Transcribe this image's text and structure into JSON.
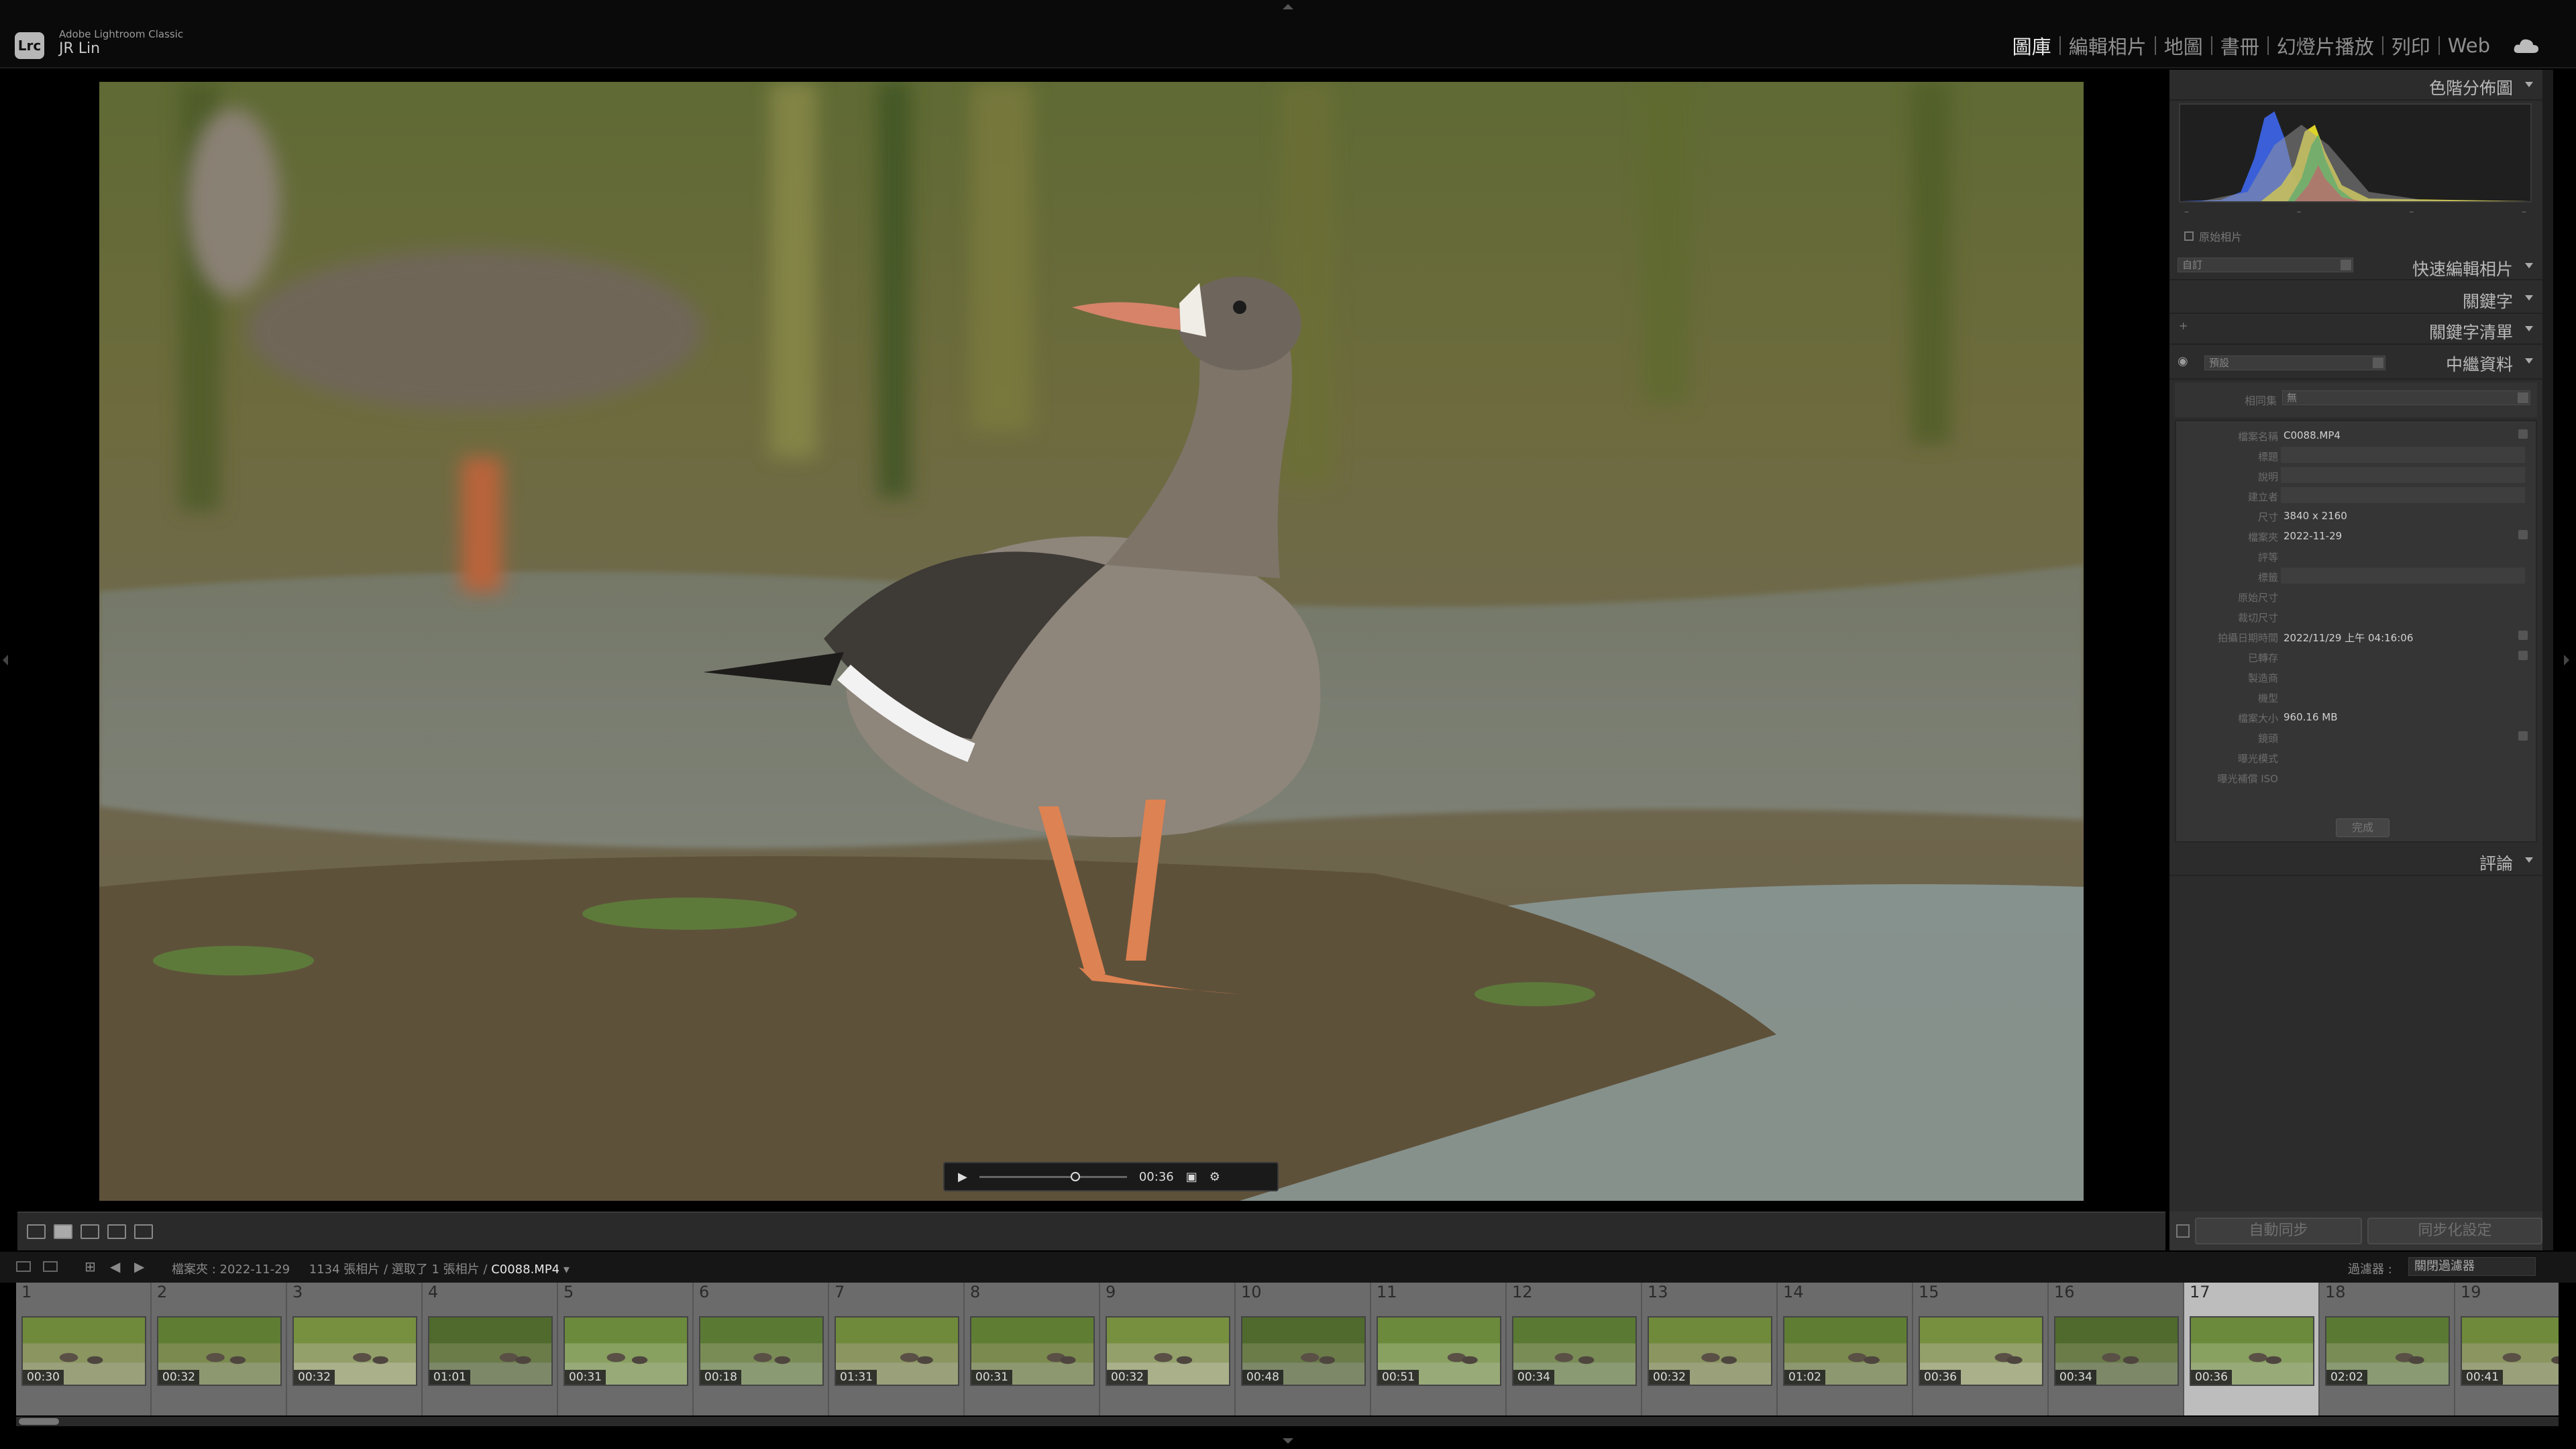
{
  "app": {
    "logo": "Lrc",
    "name": "Adobe Lightroom Classic",
    "user": "JR Lin"
  },
  "modules": [
    {
      "label": "圖庫",
      "active": true
    },
    {
      "label": "編輯相片",
      "active": false
    },
    {
      "label": "地圖",
      "active": false
    },
    {
      "label": "書冊",
      "active": false
    },
    {
      "label": "幻燈片播放",
      "active": false
    },
    {
      "label": "列印",
      "active": false
    },
    {
      "label": "Web",
      "active": false
    }
  ],
  "video": {
    "play_glyph": "▶",
    "time": "00:36",
    "progress": 0.62
  },
  "panels": {
    "histogram": "色階分佈圖",
    "quick_develop": "快速編輯相片",
    "keywording": "關鍵字",
    "keyword_list": "關鍵字清單",
    "metadata": "中繼資料",
    "comments": "評論"
  },
  "histogram": {
    "original_photo": "原始相片",
    "ticks": [
      "–",
      "–",
      "–",
      "–"
    ]
  },
  "quick_develop": {
    "preset": "自訂"
  },
  "metadata": {
    "preset": "預設",
    "target_label": "相同集",
    "target_value": "無",
    "rows": [
      {
        "label": "檔案名稱",
        "value": "C0088.MP4",
        "field": false,
        "button": true
      },
      {
        "label": "標題",
        "value": "",
        "field": true,
        "button": false
      },
      {
        "label": "說明",
        "value": "",
        "field": true,
        "button": false
      },
      {
        "label": "建立者",
        "value": "",
        "field": true,
        "button": false
      },
      {
        "label": "尺寸",
        "value": "3840 x 2160",
        "field": false,
        "button": false
      },
      {
        "label": "檔案夾",
        "value": "2022-11-29",
        "field": false,
        "button": true
      },
      {
        "label": "評等",
        "value": "",
        "field": false,
        "button": false
      },
      {
        "label": "標籤",
        "value": "",
        "field": true,
        "button": false
      },
      {
        "label": "原始尺寸",
        "value": "",
        "field": false,
        "button": false
      },
      {
        "label": "裁切尺寸",
        "value": "",
        "field": false,
        "button": false
      },
      {
        "label": "拍攝日期時間",
        "value": "2022/11/29 上午 04:16:06",
        "field": false,
        "button": true
      },
      {
        "label": "已轉存",
        "value": "",
        "field": false,
        "button": true
      },
      {
        "label": "製造商",
        "value": "",
        "field": false,
        "button": false
      },
      {
        "label": "機型",
        "value": "",
        "field": false,
        "button": false
      },
      {
        "label": "檔案大小",
        "value": "960.16 MB",
        "field": false,
        "button": false
      },
      {
        "label": "鏡頭",
        "value": "",
        "field": false,
        "button": true
      },
      {
        "label": "曝光模式",
        "value": "",
        "field": false,
        "button": false
      },
      {
        "label": "曝光補償 ISO",
        "value": "",
        "field": false,
        "button": false
      }
    ],
    "done": "完成"
  },
  "sync": {
    "auto_sync": "自動同步",
    "sync_settings": "同步化設定"
  },
  "filmstrip_bar": {
    "folder_label": "檔案夾 : 2022-11-29",
    "count": "1134 張相片 / 選取了 1 張相片 /",
    "current": "C0088.MP4",
    "filter_label": "過濾器 :",
    "filter_value": "關閉過濾器"
  },
  "filmstrip": [
    {
      "n": "1",
      "dur": "00:30"
    },
    {
      "n": "2",
      "dur": "00:32"
    },
    {
      "n": "3",
      "dur": "00:32"
    },
    {
      "n": "4",
      "dur": "01:01"
    },
    {
      "n": "5",
      "dur": "00:31"
    },
    {
      "n": "6",
      "dur": "00:18"
    },
    {
      "n": "7",
      "dur": "01:31"
    },
    {
      "n": "8",
      "dur": "00:31"
    },
    {
      "n": "9",
      "dur": "00:32"
    },
    {
      "n": "10",
      "dur": "00:48"
    },
    {
      "n": "11",
      "dur": "00:51"
    },
    {
      "n": "12",
      "dur": "00:34"
    },
    {
      "n": "13",
      "dur": "00:32"
    },
    {
      "n": "14",
      "dur": "01:02"
    },
    {
      "n": "15",
      "dur": "00:36"
    },
    {
      "n": "16",
      "dur": "00:34"
    },
    {
      "n": "17",
      "dur": "00:36",
      "active": true
    },
    {
      "n": "18",
      "dur": "02:02"
    },
    {
      "n": "19",
      "dur": "00:41"
    }
  ]
}
